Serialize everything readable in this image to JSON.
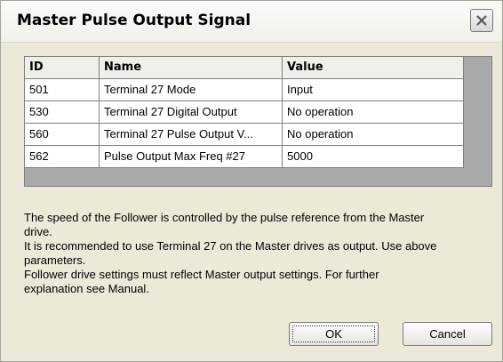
{
  "window": {
    "title": "Master Pulse Output Signal",
    "close_icon": "close-icon"
  },
  "grid": {
    "columns": [
      "ID",
      "Name",
      "Value"
    ],
    "rows": [
      {
        "id": "501",
        "name": "Terminal 27 Mode",
        "value": "Input"
      },
      {
        "id": "530",
        "name": "Terminal 27 Digital Output",
        "value": "No operation"
      },
      {
        "id": "560",
        "name": "Terminal 27 Pulse Output V...",
        "value": "No operation"
      },
      {
        "id": "562",
        "name": "Pulse Output Max Freq #27",
        "value": "5000"
      }
    ]
  },
  "description": {
    "lines": [
      "The speed of the Follower is controlled by the pulse reference from the Master",
      "drive.",
      "It is recommended to use Terminal 27 on the Master drives as output. Use above",
      "parameters.",
      "Follower drive settings must reflect Master output settings. For further",
      "explanation see Manual."
    ]
  },
  "buttons": {
    "ok": "OK",
    "cancel": "Cancel"
  }
}
